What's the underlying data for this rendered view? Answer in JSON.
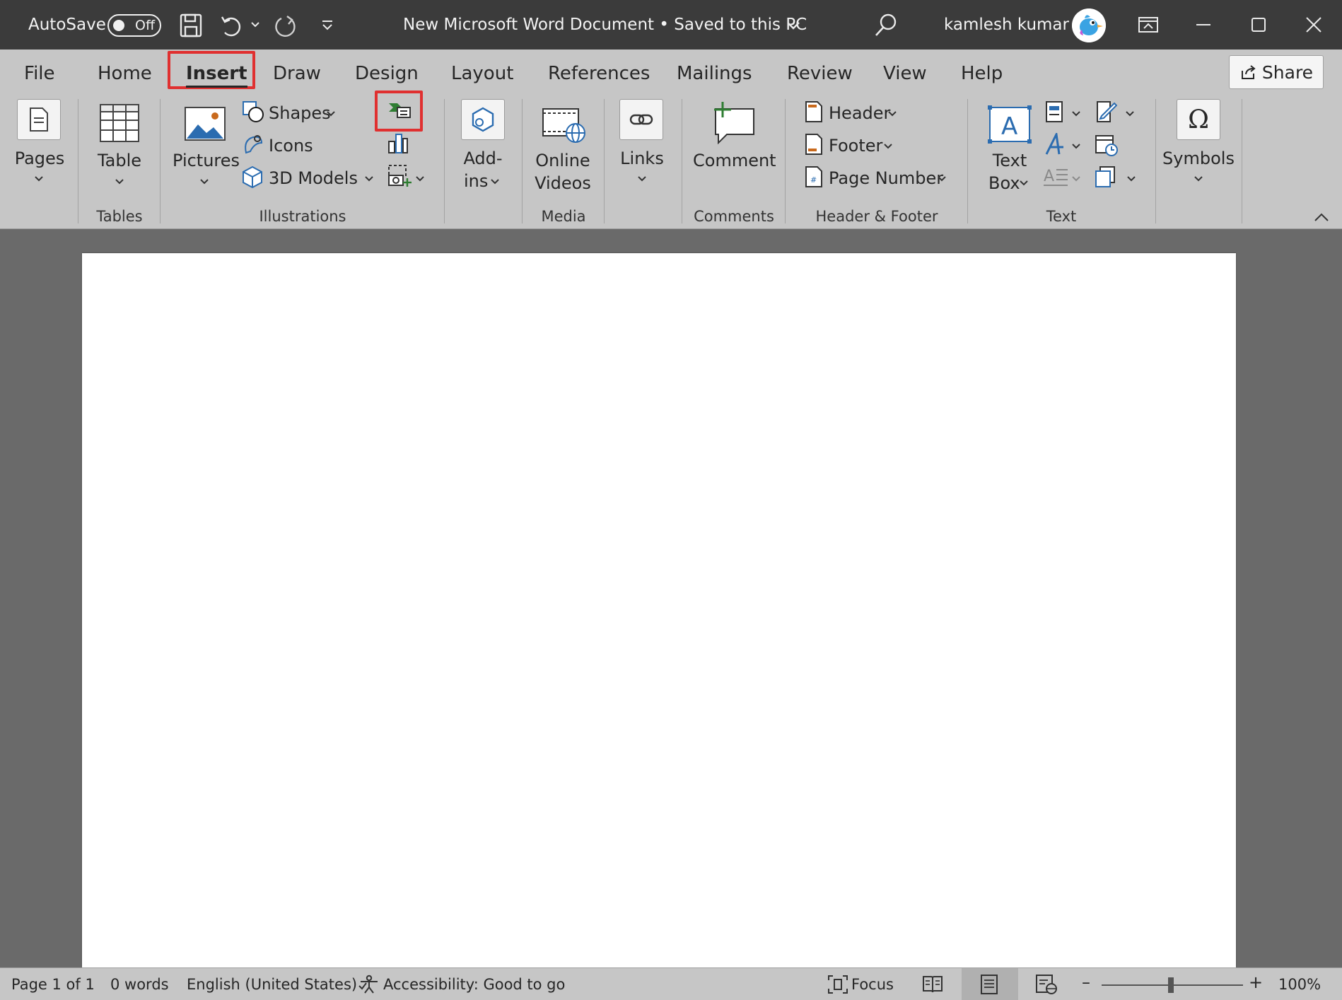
{
  "titlebar": {
    "autosave_label": "AutoSave",
    "autosave_state": "Off",
    "document_title": "New Microsoft Word Document • Saved to this PC",
    "user_name": "kamlesh kumar"
  },
  "tabs": [
    {
      "label": "File"
    },
    {
      "label": "Home"
    },
    {
      "label": "Insert",
      "active": true
    },
    {
      "label": "Draw"
    },
    {
      "label": "Design"
    },
    {
      "label": "Layout"
    },
    {
      "label": "References"
    },
    {
      "label": "Mailings"
    },
    {
      "label": "Review"
    },
    {
      "label": "View"
    },
    {
      "label": "Help"
    }
  ],
  "share_label": "Share",
  "ribbon": {
    "pages": "Pages",
    "table": "Table",
    "pictures": "Pictures",
    "shapes": "Shapes",
    "icons": "Icons",
    "models_3d": "3D Models",
    "addins_1": "Add-",
    "addins_2": "ins",
    "online_videos_1": "Online",
    "online_videos_2": "Videos",
    "links": "Links",
    "comment": "Comment",
    "header": "Header",
    "footer": "Footer",
    "page_number": "Page Number",
    "textbox_1": "Text",
    "textbox_2": "Box",
    "symbols": "Symbols",
    "groups": {
      "tables": "Tables",
      "illustrations": "Illustrations",
      "media": "Media",
      "comments": "Comments",
      "header_footer": "Header & Footer",
      "text": "Text"
    }
  },
  "status": {
    "page": "Page 1 of 1",
    "words": "0 words",
    "language": "English (United States)",
    "accessibility": "Accessibility: Good to go",
    "focus": "Focus",
    "zoom_minus": "–",
    "zoom_plus": "+",
    "zoom": "100%"
  },
  "colors": {
    "titlebar": "#3b3b3b",
    "ribbon": "#c6c6c6",
    "workspace": "#6a6a6a",
    "highlight_box": "#e03030",
    "icon_blue": "#2b6cb0",
    "icon_green": "#2e7d32"
  }
}
